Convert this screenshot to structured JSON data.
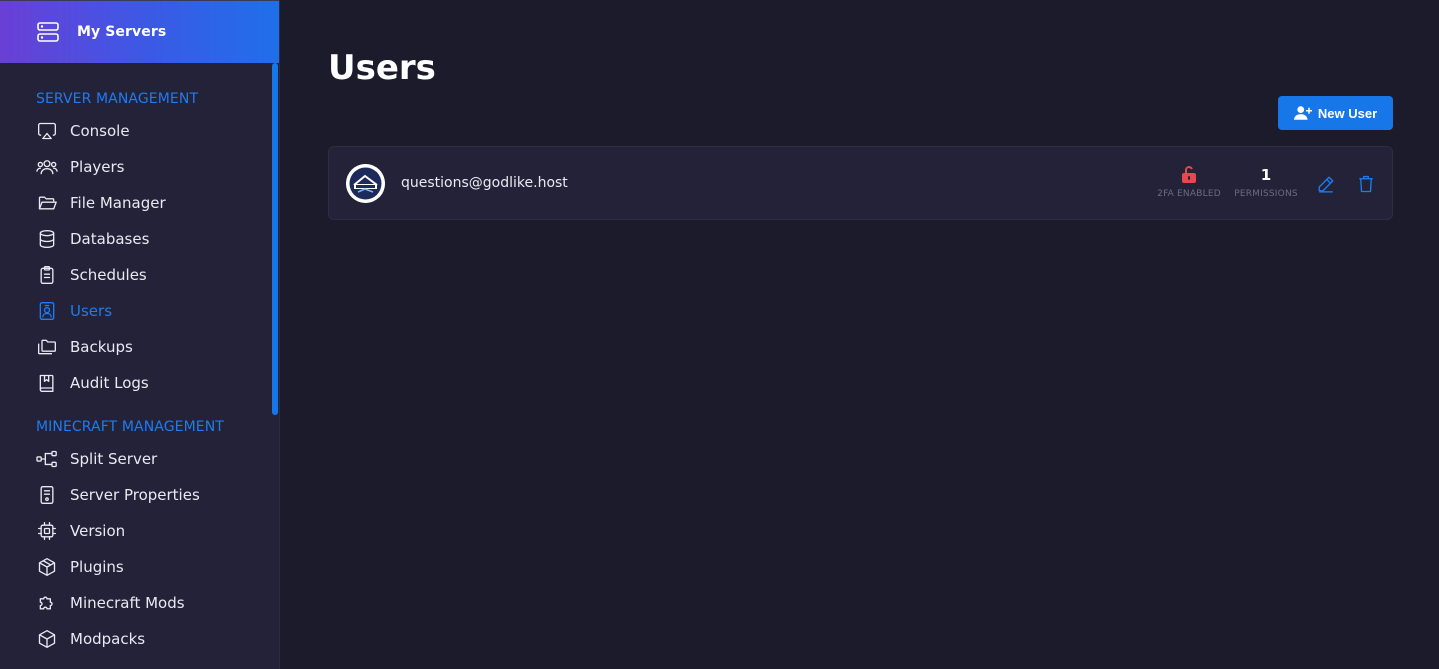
{
  "brand": {
    "title": "My Servers"
  },
  "sidebar": {
    "server_management": {
      "title": "SERVER MANAGEMENT",
      "items": [
        {
          "label": "Console",
          "icon": "console-icon"
        },
        {
          "label": "Players",
          "icon": "players-icon"
        },
        {
          "label": "File Manager",
          "icon": "folder-icon"
        },
        {
          "label": "Databases",
          "icon": "database-icon"
        },
        {
          "label": "Schedules",
          "icon": "clipboard-icon"
        },
        {
          "label": "Users",
          "icon": "user-badge-icon",
          "active": true
        },
        {
          "label": "Backups",
          "icon": "folders-icon"
        },
        {
          "label": "Audit Logs",
          "icon": "book-icon"
        }
      ]
    },
    "minecraft_management": {
      "title": "MINECRAFT MANAGEMENT",
      "items": [
        {
          "label": "Split Server",
          "icon": "split-icon"
        },
        {
          "label": "Server Properties",
          "icon": "file-settings-icon"
        },
        {
          "label": "Version",
          "icon": "chip-icon"
        },
        {
          "label": "Plugins",
          "icon": "boxes-icon"
        },
        {
          "label": "Minecraft Mods",
          "icon": "puzzle-icon"
        },
        {
          "label": "Modpacks",
          "icon": "cube-icon"
        }
      ]
    }
  },
  "main": {
    "title": "Users",
    "new_user_label": "New User",
    "users": [
      {
        "email": "questions@godlike.host",
        "twofa_label": "2FA ENABLED",
        "permissions_count": "1",
        "permissions_label": "PERMISSIONS"
      }
    ]
  },
  "colors": {
    "accent": "#1e7cf0",
    "background": "#1c1b2b",
    "sidebar": "#232239",
    "danger": "#e5484d"
  }
}
